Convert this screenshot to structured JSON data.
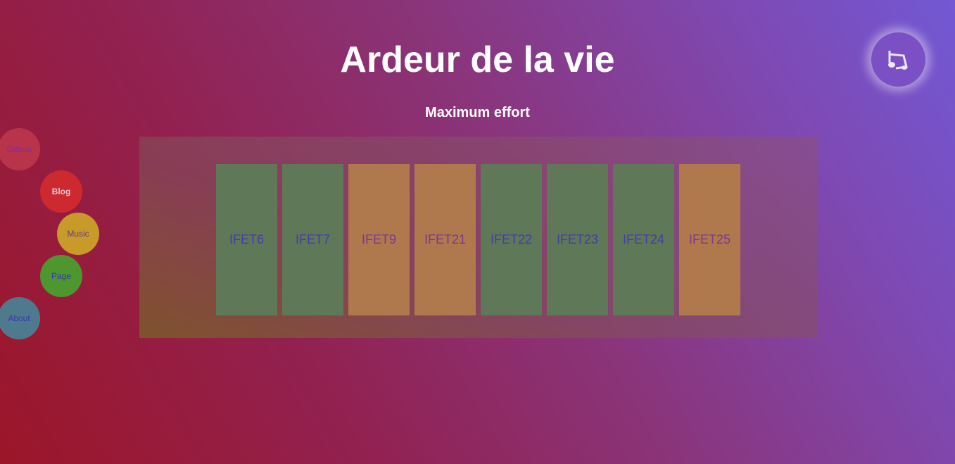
{
  "header": {
    "title": "Ardeur de la vie",
    "subtitle": "Maximum effort"
  },
  "music_button": {
    "icon": "music-note-icon"
  },
  "nav": [
    {
      "label": "Github",
      "color": "#b8344a",
      "text_color": "#8a2aa0"
    },
    {
      "label": "Blog",
      "color": "#cc2a2e",
      "text_color": "#e8c8d0"
    },
    {
      "label": "Music",
      "color": "#c89a2a",
      "text_color": "#6a3a8a"
    },
    {
      "label": "Page",
      "color": "#4e962e",
      "text_color": "#3a3aa8"
    },
    {
      "label": "About",
      "color": "#4f7a8e",
      "text_color": "#3a3aa8"
    }
  ],
  "cards": [
    {
      "label": "IFET6",
      "tone": "green"
    },
    {
      "label": "IFET7",
      "tone": "green"
    },
    {
      "label": "IFET9",
      "tone": "orange"
    },
    {
      "label": "IFET21",
      "tone": "orange"
    },
    {
      "label": "IFET22",
      "tone": "green"
    },
    {
      "label": "IFET23",
      "tone": "green"
    },
    {
      "label": "IFET24",
      "tone": "green"
    },
    {
      "label": "IFET25",
      "tone": "orange"
    }
  ]
}
